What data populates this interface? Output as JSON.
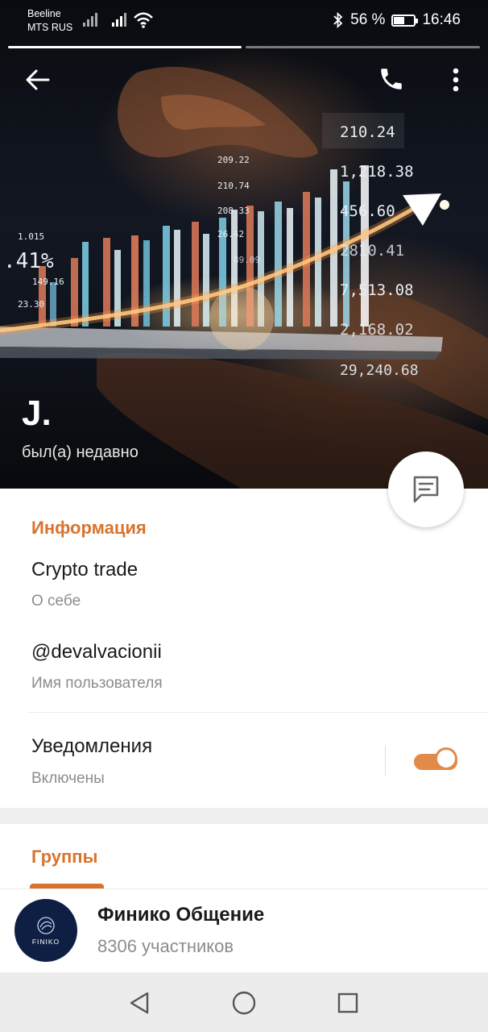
{
  "status_bar": {
    "carrier_1": "Beeline",
    "carrier_2": "MTS RUS",
    "battery_percent": "56 %",
    "battery_level": 0.56,
    "time": "16:46"
  },
  "story_progress": {
    "segments": 2,
    "active": 1
  },
  "profile": {
    "name": "J.",
    "last_seen": "был(а) недавно"
  },
  "cover_labels": [
    "210.24",
    "1,218.38",
    "456.60",
    "2810.41",
    "7,513.08",
    "2,168.02",
    "29,240.68",
    "209.22",
    "210.74",
    "208.33",
    "26.42",
    "89.09",
    "1.015",
    ".41%",
    "149.16",
    "23.30"
  ],
  "info": {
    "title": "Информация",
    "bio_value": "Crypto trade",
    "bio_label": "О себе",
    "username_value": "@devalvacionii",
    "username_label": "Имя пользователя",
    "notifications_value": "Уведомления",
    "notifications_label": "Включены",
    "notifications_on": true
  },
  "groups": {
    "title": "Группы",
    "items": [
      {
        "name": "Финико Общение",
        "members": "8306 участников",
        "avatar_text": "FINIKO"
      }
    ]
  },
  "icons": [
    "back-arrow-icon",
    "phone-icon",
    "more-vert-icon",
    "message-icon",
    "nav-back-icon",
    "nav-home-icon",
    "nav-recents-icon",
    "bluetooth-icon",
    "wifi-icon",
    "signal-icon"
  ],
  "colors": {
    "accent": "#d8732d",
    "toggle": "#e28a4a",
    "avatar_bg": "#0f1f43"
  }
}
